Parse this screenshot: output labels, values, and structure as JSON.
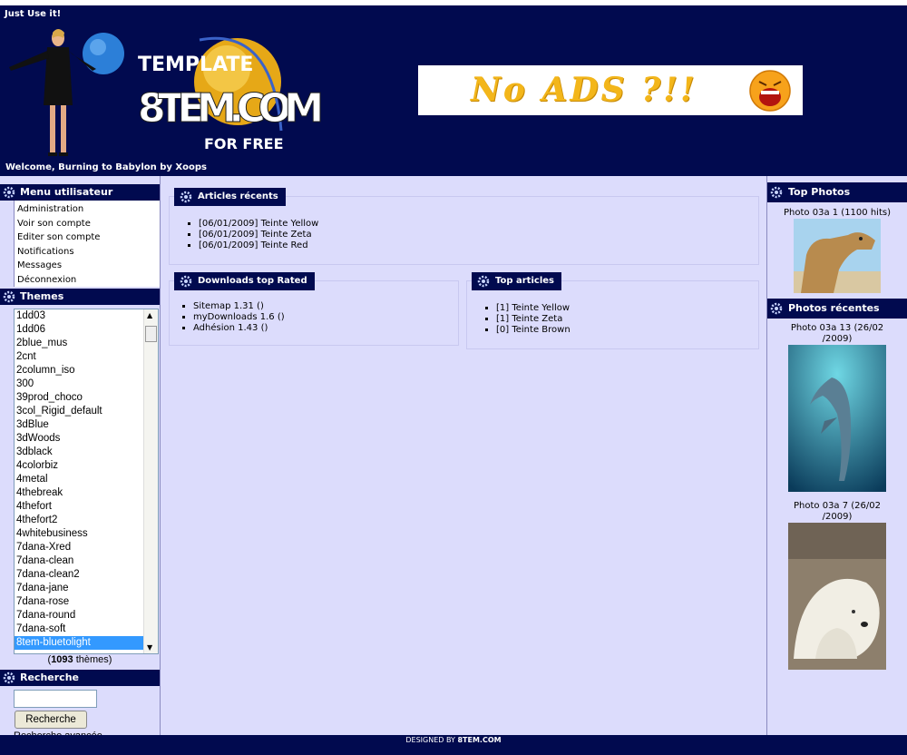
{
  "header": {
    "tagline": "Just Use it!",
    "welcome": "Welcome, Burning to Babylon by Xoops",
    "logo_top": "TEMPLATE",
    "logo_main": "8TEM.COM",
    "logo_bottom": "FOR FREE",
    "banner_text": "No ADS ?!!"
  },
  "user_menu": {
    "title": "Menu utilisateur",
    "items": [
      "Administration",
      "Voir son compte",
      "Editer son compte",
      "Notifications",
      "Messages",
      "Déconnexion"
    ]
  },
  "themes": {
    "title": "Themes",
    "options": [
      "1dd03",
      "1dd06",
      "2blue_mus",
      "2cnt",
      "2column_iso",
      "300",
      "39prod_choco",
      "3col_Rigid_default",
      "3dBlue",
      "3dWoods",
      "3dblack",
      "4colorbiz",
      "4metal",
      "4thebreak",
      "4thefort",
      "4thefort2",
      "4whitebusiness",
      "7dana-Xred",
      "7dana-clean",
      "7dana-clean2",
      "7dana-jane",
      "7dana-rose",
      "7dana-round",
      "7dana-soft",
      "8tem-bluetolight"
    ],
    "selected": "8tem-bluetolight",
    "count_open": "(",
    "count": "1093",
    "count_suffix": " thèmes)"
  },
  "search": {
    "title": "Recherche",
    "input_value": "",
    "button_label": "Recherche",
    "advanced_link": "Recherche avancée"
  },
  "articles_recents": {
    "title": "Articles récents",
    "items": [
      "[06/01/2009] Teinte Yellow",
      "[06/01/2009] Teinte Zeta",
      "[06/01/2009] Teinte Red"
    ]
  },
  "downloads_top": {
    "title": "Downloads top Rated",
    "items": [
      "Sitemap 1.31 ()",
      "myDownloads 1.6 ()",
      "Adhésion 1.43 ()"
    ]
  },
  "top_articles": {
    "title": "Top articles",
    "items": [
      "[1] Teinte Yellow",
      "[1] Teinte Zeta",
      "[0] Teinte Brown"
    ]
  },
  "top_photos": {
    "title": "Top Photos",
    "caption": "Photo 03a 1 (1100 hits)"
  },
  "recent_photos": {
    "title": "Photos récentes",
    "photos": [
      {
        "caption_line1": "Photo 03a 13 (26/02",
        "caption_line2": "/2009)"
      },
      {
        "caption_line1": "Photo 03a 7 (26/02",
        "caption_line2": "/2009)"
      }
    ]
  },
  "footer": {
    "prefix": "DESIGNED BY ",
    "brand": "8TEM.COM"
  },
  "colors": {
    "header_bg": "#010a4f",
    "page_bg": "#dcdcfc",
    "selected_theme": "#3399ff",
    "banner_text": "#f3b61a"
  }
}
